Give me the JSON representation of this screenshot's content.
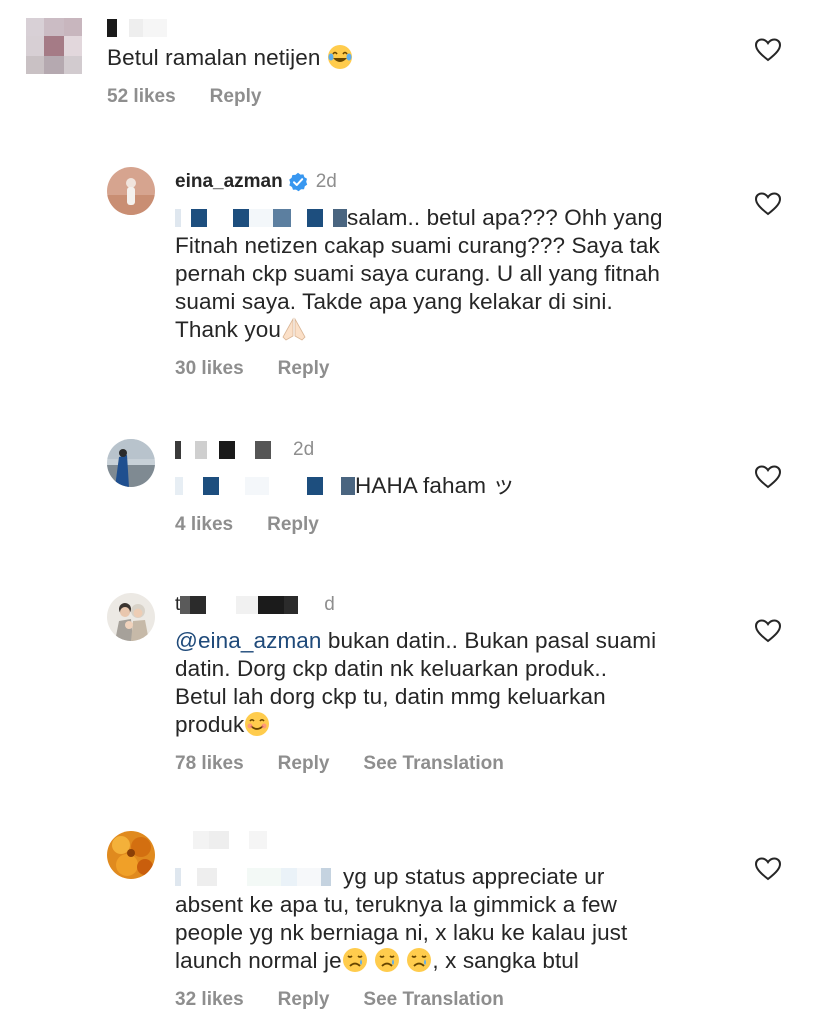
{
  "comments": [
    {
      "username": "",
      "time": "",
      "text": "Betul ramalan netijen",
      "likes": "52 likes",
      "reply": "Reply"
    },
    {
      "username": "eina_azman",
      "time": "2d",
      "text_lines": [
        "salam.. betul apa??? Ohh yang",
        "Fitnah netizen cakap suami curang??? Saya tak",
        "pernah ckp suami saya curang. U all yang fitnah",
        "suami saya. Takde apa yang kelakar di sini.",
        "Thank you"
      ],
      "likes": "30 likes",
      "reply": "Reply"
    },
    {
      "username": "",
      "time": "2d",
      "text": "HAHA faham ッ",
      "likes": "4 likes",
      "reply": "Reply"
    },
    {
      "username": "t",
      "time": "d",
      "mention": "@eina_azman",
      "text_lines": [
        " bukan datin.. Bukan pasal suami",
        "datin. Dorg ckp datin nk keluarkan produk..",
        "Betul lah dorg ckp tu, datin mmg keluarkan",
        "produk"
      ],
      "likes": "78 likes",
      "reply": "Reply",
      "translate": "See Translation"
    },
    {
      "username": "",
      "time": "",
      "text_lines": [
        "yg up status appreciate ur",
        "absent ke apa tu, teruknya la gimmick a few",
        "people yg nk berniaga ni, x laku ke kalau just",
        "launch normal je",
        ", x sangka btul"
      ],
      "likes": "32 likes",
      "reply": "Reply",
      "translate": "See Translation"
    }
  ],
  "icons": {
    "heart": "heart-outline-icon",
    "verified": "verified-badge-icon",
    "emoji_laugh": "face-with-tears-of-joy",
    "emoji_pray": "folded-hands",
    "emoji_smile": "smiling-face",
    "emoji_cry": "crying-face"
  },
  "colors": {
    "text": "#262626",
    "muted": "#8e8e8e",
    "mention": "#1f4a7a",
    "verified": "#3897f0"
  }
}
